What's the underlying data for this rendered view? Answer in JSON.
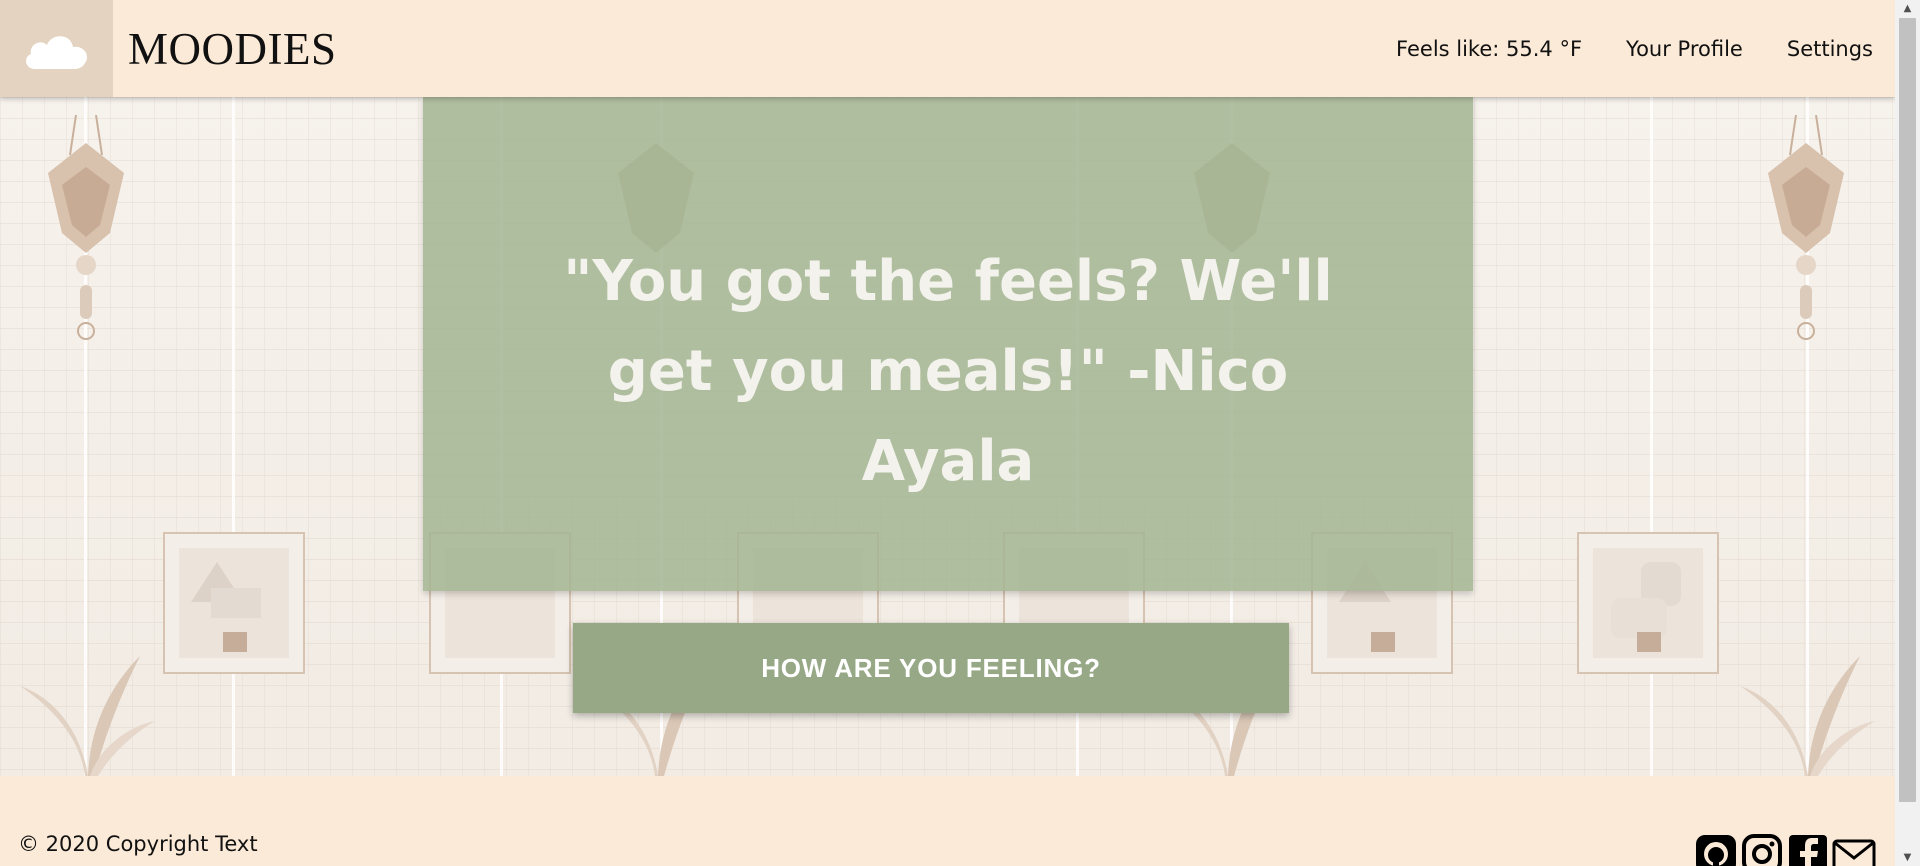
{
  "header": {
    "brand": "MOODIES",
    "weather": "Feels like: 55.4 °F",
    "nav": [
      {
        "label": "Your Profile"
      },
      {
        "label": "Settings"
      }
    ]
  },
  "hero": {
    "quote": "\"You got the feels? We'll get you meals!\" -Nico Ayala",
    "cta_label": "HOW ARE YOU FEELING?"
  },
  "footer": {
    "copyright": "© 2020 Copyright Text",
    "social_icons": [
      "github-icon",
      "instagram-icon",
      "facebook-icon",
      "mail-icon"
    ]
  },
  "colors": {
    "header_bg": "#fbead7",
    "logo_bg": "#e3d3c0",
    "quote_card": "#a3b593",
    "cta_bg": "#97a887",
    "wall": "#f5f1ec"
  }
}
